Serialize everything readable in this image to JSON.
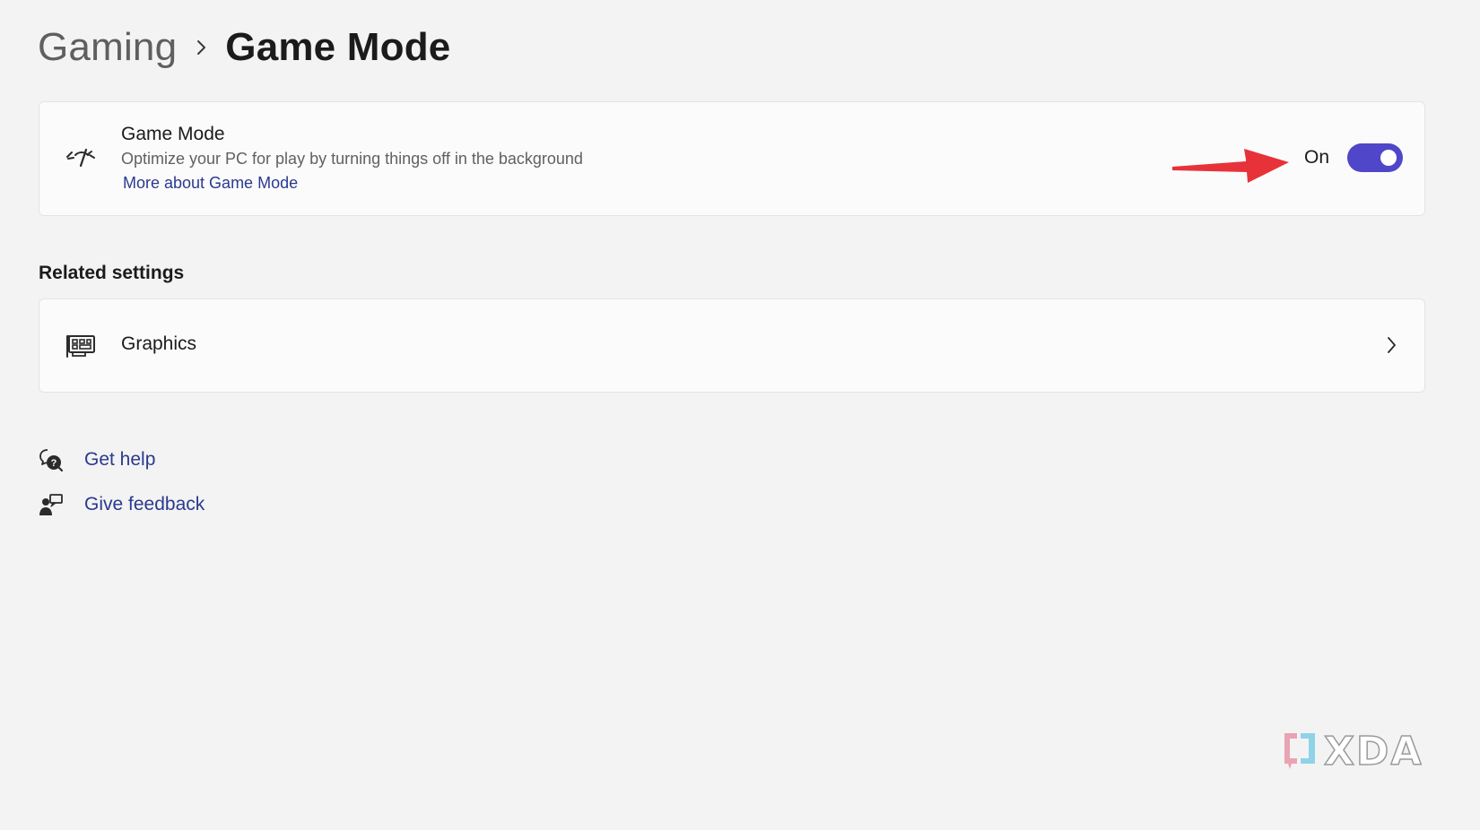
{
  "breadcrumb": {
    "parent": "Gaming",
    "current": "Game Mode"
  },
  "game_mode_card": {
    "icon": "game-mode-gauge-icon",
    "title": "Game Mode",
    "description": "Optimize your PC for play by turning things off in the background",
    "link": "More about Game Mode",
    "toggle_state_label": "On",
    "toggle_on": true
  },
  "annotation": {
    "arrow_color": "#e8323a"
  },
  "related_settings": {
    "heading": "Related settings",
    "items": [
      {
        "icon": "graphics-card-icon",
        "label": "Graphics"
      }
    ]
  },
  "help": {
    "get_help": "Get help",
    "give_feedback": "Give feedback"
  },
  "watermark": {
    "text": "XDA"
  },
  "colors": {
    "accent": "#4f46c9",
    "link": "#2a3a8f",
    "background": "#f3f3f3",
    "card": "#fbfbfb"
  }
}
